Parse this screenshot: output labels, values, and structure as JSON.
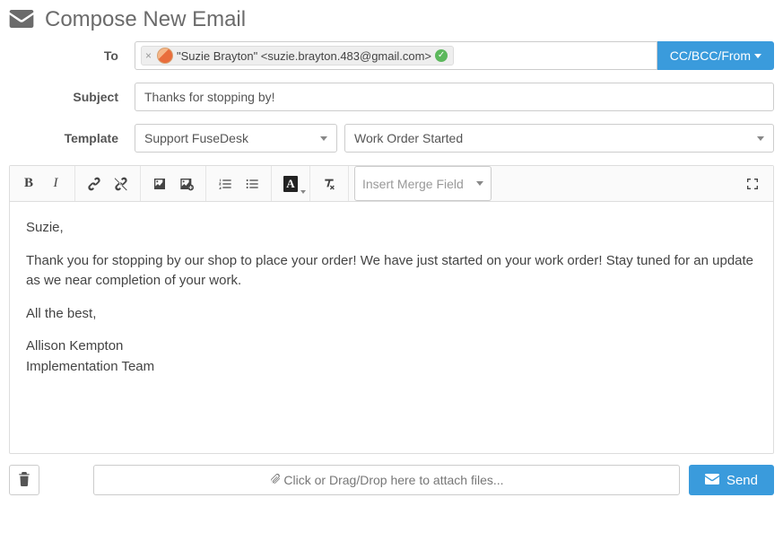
{
  "header": {
    "title": "Compose New Email"
  },
  "labels": {
    "to": "To",
    "subject": "Subject",
    "template": "Template"
  },
  "to": {
    "chip_text": "\"Suzie Brayton\" <suzie.brayton.483@gmail.com>",
    "cc_button": "CC/BCC/From"
  },
  "subject": {
    "value": "Thanks for stopping by!"
  },
  "template": {
    "group": "Support FuseDesk",
    "name": "Work Order Started"
  },
  "toolbar": {
    "bold": "B",
    "italic": "I",
    "merge_placeholder": "Insert Merge Field"
  },
  "body": {
    "p1": "Suzie,",
    "p2": "Thank you for stopping by our shop to place your order! We have just started on your work order! Stay tuned for an update as we near completion of your work.",
    "p3": "All the best,",
    "p4": "Allison Kempton",
    "p5": "Implementation Team"
  },
  "footer": {
    "attach_text": "Click or Drag/Drop here to attach files...",
    "send": "Send"
  }
}
